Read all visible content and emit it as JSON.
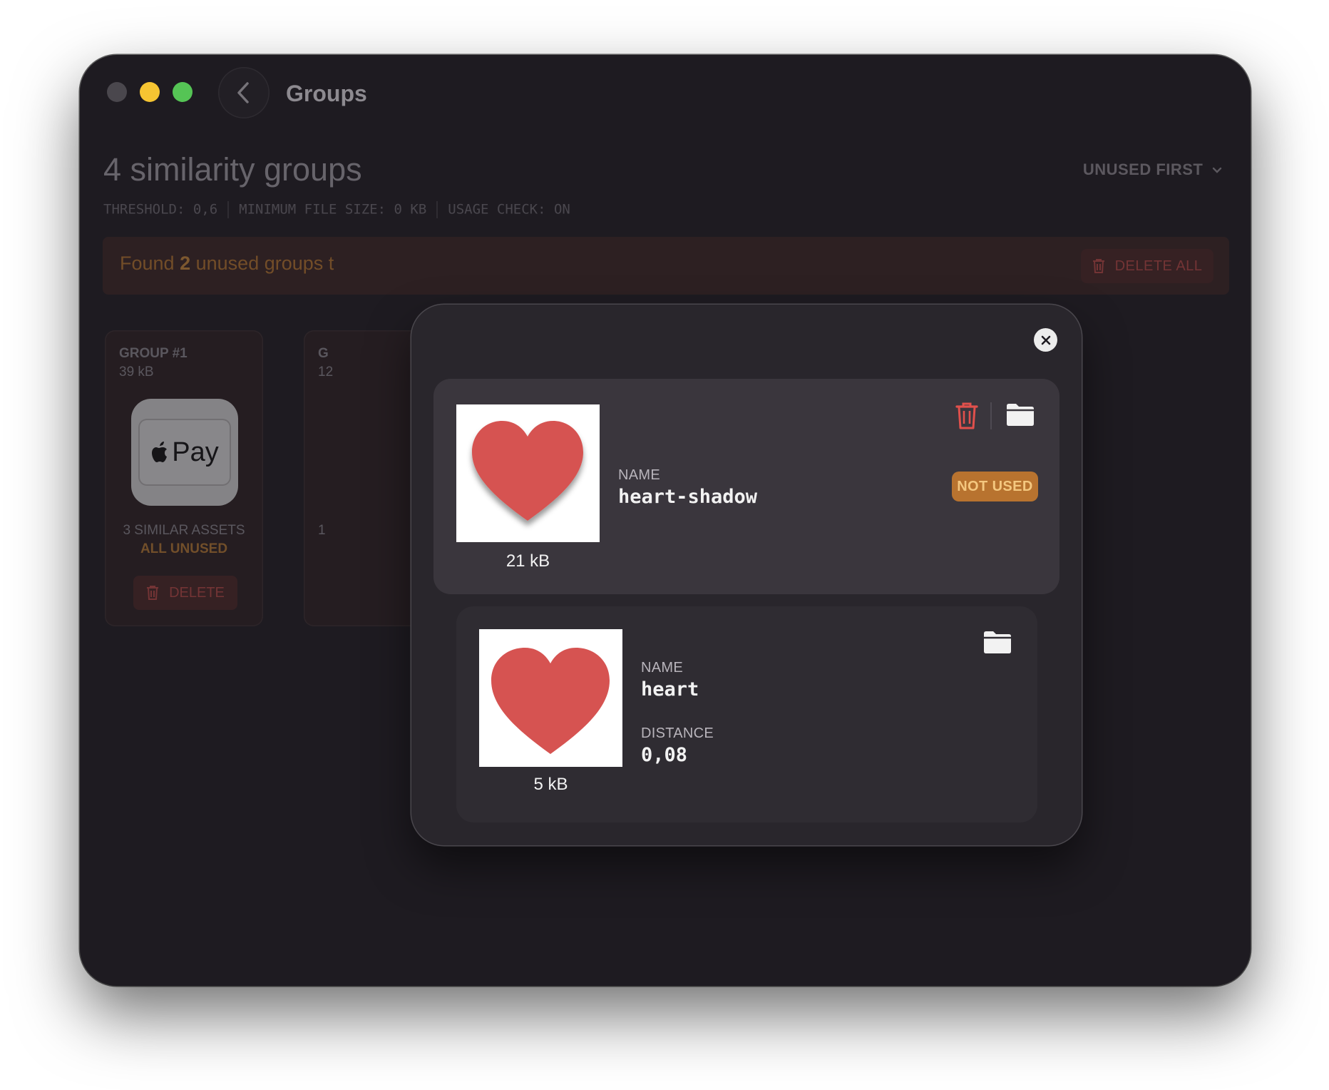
{
  "window": {
    "title": "Groups"
  },
  "header": {
    "heading": "4 similarity groups",
    "sort_label": "UNUSED FIRST",
    "meta": {
      "threshold": "THRESHOLD: 0,6",
      "min_file_size": "MINIMUM FILE SIZE: 0 KB",
      "usage_check": "USAGE CHECK: ON"
    }
  },
  "banner": {
    "text_prefix": "Found",
    "count": "2",
    "text_suffix": "unused groups t",
    "delete_all_label": "DELETE ALL"
  },
  "groups": [
    {
      "title": "GROUP #1",
      "size": "39 kB",
      "thumb_label": "Pay",
      "similar": "3 SIMILAR ASSETS",
      "status": "ALL UNUSED",
      "delete_label": "DELETE"
    },
    {
      "title": "G",
      "size": "12",
      "similar": "1"
    }
  ],
  "modal": {
    "assets": [
      {
        "name_label": "NAME",
        "name": "heart-shadow",
        "size": "21 kB",
        "badge": "NOT USED"
      },
      {
        "name_label": "NAME",
        "name": "heart",
        "size": "5 kB",
        "distance_label": "DISTANCE",
        "distance": "0,08"
      }
    ]
  },
  "colors": {
    "accent_red": "#d75250",
    "badge_orange": "#b8732f",
    "window_bg": "#1e1b21"
  },
  "icons": {
    "trash": "trash-icon",
    "folder": "folder-icon",
    "close": "close-icon",
    "back": "chevron-left-icon",
    "sort": "chevron-down-icon"
  }
}
